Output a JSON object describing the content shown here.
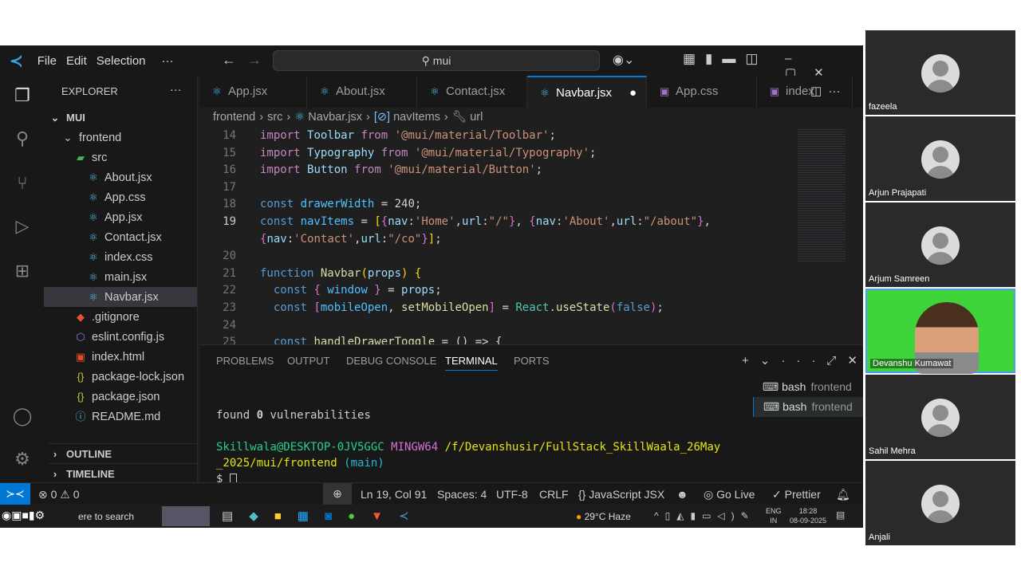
{
  "titlebar": {
    "menus": [
      "File",
      "Edit",
      "Selection",
      "···"
    ],
    "search": "mui"
  },
  "explorer": {
    "title": "EXPLORER",
    "root": "MUI",
    "items": [
      {
        "label": "frontend",
        "icon": "chevron-down",
        "indent": 1
      },
      {
        "label": "src",
        "icon": "folder",
        "indent": 2
      },
      {
        "label": "About.jsx",
        "icon": "react",
        "indent": 3
      },
      {
        "label": "App.css",
        "icon": "react",
        "indent": 3
      },
      {
        "label": "App.jsx",
        "icon": "react",
        "indent": 3
      },
      {
        "label": "Contact.jsx",
        "icon": "react",
        "indent": 3
      },
      {
        "label": "index.css",
        "icon": "react",
        "indent": 3
      },
      {
        "label": "main.jsx",
        "icon": "react",
        "indent": 3
      },
      {
        "label": "Navbar.jsx",
        "icon": "react",
        "indent": 3,
        "selected": true
      },
      {
        "label": ".gitignore",
        "icon": "git",
        "indent": 2
      },
      {
        "label": "eslint.config.js",
        "icon": "eslint",
        "indent": 2
      },
      {
        "label": "index.html",
        "icon": "html",
        "indent": 2
      },
      {
        "label": "package-lock.json",
        "icon": "json",
        "indent": 2
      },
      {
        "label": "package.json",
        "icon": "json",
        "indent": 2
      },
      {
        "label": "README.md",
        "icon": "info",
        "indent": 2
      }
    ],
    "outline": "OUTLINE",
    "timeline": "TIMELINE"
  },
  "tabs": [
    {
      "label": "App.jsx"
    },
    {
      "label": "About.jsx"
    },
    {
      "label": "Contact.jsx"
    },
    {
      "label": "Navbar.jsx",
      "active": true
    },
    {
      "label": "App.css"
    },
    {
      "label": "index"
    }
  ],
  "breadcrumb": [
    "frontend",
    "src",
    "Navbar.jsx",
    "navItems",
    "url"
  ],
  "code": [
    {
      "n": "14",
      "t": [
        [
          "im",
          "import "
        ],
        [
          "vr",
          "Toolbar "
        ],
        [
          "im",
          "from "
        ],
        [
          "st",
          "'@mui/material/Toolbar'"
        ],
        [
          "pl",
          ";"
        ]
      ]
    },
    {
      "n": "15",
      "t": [
        [
          "im",
          "import "
        ],
        [
          "vr",
          "Typography "
        ],
        [
          "im",
          "from "
        ],
        [
          "st",
          "'@mui/material/Typography'"
        ],
        [
          "pl",
          ";"
        ]
      ]
    },
    {
      "n": "16",
      "t": [
        [
          "im",
          "import "
        ],
        [
          "vr",
          "Button "
        ],
        [
          "im",
          "from "
        ],
        [
          "st",
          "'@mui/material/Button'"
        ],
        [
          "pl",
          ";"
        ]
      ]
    },
    {
      "n": "17",
      "t": []
    },
    {
      "n": "18",
      "t": [
        [
          "kw",
          "const "
        ],
        [
          "cs",
          "drawerWidth"
        ],
        [
          "pl",
          " = "
        ],
        [
          "pl",
          "240;"
        ]
      ]
    },
    {
      "n": "19",
      "cur": true,
      "t": [
        [
          "kw",
          "const "
        ],
        [
          "cs",
          "navItems"
        ],
        [
          "pl",
          " = "
        ],
        [
          "br1",
          "["
        ],
        [
          "br2",
          "{"
        ],
        [
          "vr",
          "nav"
        ],
        [
          "pl",
          ":"
        ],
        [
          "st",
          "'Home'"
        ],
        [
          "pl",
          ","
        ],
        [
          "vr",
          "url"
        ],
        [
          "pl",
          ":"
        ],
        [
          "st",
          "\"/\""
        ],
        [
          "br2",
          "}"
        ],
        [
          "pl",
          ", "
        ],
        [
          "br2",
          "{"
        ],
        [
          "vr",
          "nav"
        ],
        [
          "pl",
          ":"
        ],
        [
          "st",
          "'About'"
        ],
        [
          "pl",
          ","
        ],
        [
          "vr",
          "url"
        ],
        [
          "pl",
          ":"
        ],
        [
          "st",
          "\"/about\""
        ],
        [
          "br2",
          "}"
        ],
        [
          "pl",
          ","
        ]
      ]
    },
    {
      "n": "",
      "t": [
        [
          "br2",
          "{"
        ],
        [
          "vr",
          "nav"
        ],
        [
          "pl",
          ":"
        ],
        [
          "st",
          "'Contact'"
        ],
        [
          "pl",
          ","
        ],
        [
          "vr",
          "url"
        ],
        [
          "pl",
          ":"
        ],
        [
          "st",
          "\"/co\""
        ],
        [
          "br2",
          "}"
        ],
        [
          "br1",
          "]"
        ],
        [
          "pl",
          ";"
        ]
      ]
    },
    {
      "n": "20",
      "t": []
    },
    {
      "n": "21",
      "t": [
        [
          "kw",
          "function "
        ],
        [
          "fn",
          "Navbar"
        ],
        [
          "br1",
          "("
        ],
        [
          "vr",
          "props"
        ],
        [
          "br1",
          ")"
        ],
        [
          "pl",
          " "
        ],
        [
          "br1",
          "{"
        ]
      ]
    },
    {
      "n": "22",
      "t": [
        [
          "pl",
          "  "
        ],
        [
          "kw",
          "const "
        ],
        [
          "br2",
          "{ "
        ],
        [
          "cs",
          "window"
        ],
        [
          "br2",
          " }"
        ],
        [
          "pl",
          " = "
        ],
        [
          "vr",
          "props"
        ],
        [
          "pl",
          ";"
        ]
      ]
    },
    {
      "n": "23",
      "t": [
        [
          "pl",
          "  "
        ],
        [
          "kw",
          "const "
        ],
        [
          "br2",
          "["
        ],
        [
          "cs",
          "mobileOpen"
        ],
        [
          "pl",
          ", "
        ],
        [
          "fn",
          "setMobileOpen"
        ],
        [
          "br2",
          "]"
        ],
        [
          "pl",
          " = "
        ],
        [
          "ty",
          "React"
        ],
        [
          "pl",
          "."
        ],
        [
          "fn",
          "useState"
        ],
        [
          "br2",
          "("
        ],
        [
          "kw",
          "false"
        ],
        [
          "br2",
          ")"
        ],
        [
          "pl",
          ";"
        ]
      ]
    },
    {
      "n": "24",
      "t": []
    },
    {
      "n": "25",
      "t": [
        [
          "pl",
          "  "
        ],
        [
          "kw",
          "const "
        ],
        [
          "fn",
          "handleDrawerToggle"
        ],
        [
          "pl",
          " = () => {"
        ]
      ]
    }
  ],
  "panel": {
    "tabs": [
      "PROBLEMS",
      "OUTPUT",
      "DEBUG CONSOLE",
      "TERMINAL",
      "PORTS"
    ],
    "active": "TERMINAL",
    "terminals": [
      {
        "label": "bash",
        "cwd": "frontend"
      },
      {
        "label": "bash",
        "cwd": "frontend"
      }
    ],
    "out1a": "found ",
    "out1b": "0",
    "out1c": " vulnerabilities",
    "user": "Skillwala@DESKTOP-0JV5GGC",
    "shell": "MINGW64",
    "path1": "/f/Devanshusir/FullStack_SkillWaala_26May",
    "path2": "_2025/mui/frontend",
    "branch": "(main)",
    "prompt": "$"
  },
  "status": {
    "errors": "0",
    "warnings": "0",
    "position": "Ln 19, Col 91",
    "spaces": "Spaces: 4",
    "encoding": "UTF-8",
    "eol": "CRLF",
    "language": "JavaScript JSX",
    "golive": "Go Live",
    "prettier": "Prettier"
  },
  "taskbar": {
    "search": "ere to search",
    "weather": "29°C  Haze",
    "lang1": "ENG",
    "lang2": "IN",
    "time": "18:28",
    "date": "08-09-2025"
  },
  "participants": [
    {
      "name": "fazeela"
    },
    {
      "name": "Arjun Prajapati"
    },
    {
      "name": "Arjum Samreen"
    },
    {
      "name": "Devanshu Kumawat",
      "video": true
    },
    {
      "name": "Sahil Mehra"
    },
    {
      "name": "Anjali"
    }
  ],
  "colors": {
    "accent": "#0078d4",
    "active_speaker": "#4a9ff5"
  }
}
